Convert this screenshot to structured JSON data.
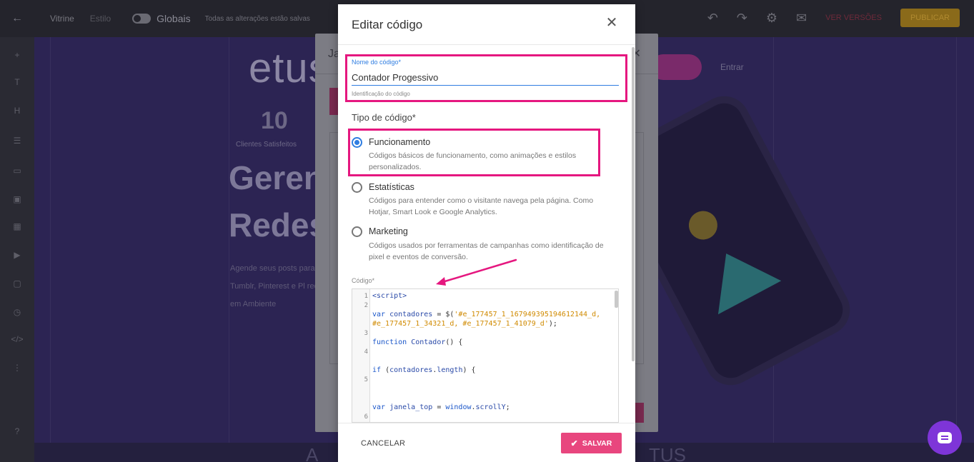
{
  "background": {
    "topbar": {
      "back_icon": "arrow-left-icon",
      "page_label": "Vitrine",
      "dim_label": "Estilo",
      "globais_label": "Globais",
      "autosave_text": "Todas as alterações estão salvas",
      "version_label": "VER VERSÕES",
      "publish_label": "PUBLICAR"
    },
    "canvas": {
      "logo": "etus",
      "stat_number": "10",
      "stat_label": "Clientes Satisfeitos",
      "hero_line1": "Geren",
      "hero_line2": "Redes",
      "paragraph": "Agende seus posts para Tumblr, Pinterest e Pl redes em Ambiente",
      "entrar_label": "Entrar",
      "bottom_text_left": "A",
      "bottom_text_right": "TUS"
    },
    "mid_dialog": {
      "title": "Ja"
    }
  },
  "modal": {
    "title": "Editar código",
    "close_icon": "close-icon",
    "name_field": {
      "label": "Nome do código*",
      "value": "Contador Progessivo",
      "helper": "Identificação do código"
    },
    "type_label": "Tipo de código*",
    "options": [
      {
        "title": "Funcionamento",
        "description": "Códigos básicos de funcionamento, como animações e estilos personalizados.",
        "selected": true
      },
      {
        "title": "Estatísticas",
        "description": "Códigos para entender como o visitante navega pela página. Como Hotjar, Smart Look e Google Analytics.",
        "selected": false
      },
      {
        "title": "Marketing",
        "description": "Códigos usados por ferramentas de campanhas como identificação de pixel e eventos de conversão.",
        "selected": false
      }
    ],
    "code_label": "Código*",
    "code_lines": {
      "n1": "1",
      "n2": "2",
      "n3": "3",
      "n4": "4",
      "n5": "5",
      "n6": "6",
      "l1": "<script>",
      "l2a_kw": "var",
      "l2a_var": " contadores",
      "l2a_op": " = $(",
      "l2a_str": "'#e_177457_1_167949395194612144_d,",
      "l2b_str": "#e_177457_1_34321_d, #e_177457_1_41079_d'",
      "l2b_end": ");",
      "l3_kw": "function",
      "l3_name": " Contador",
      "l3_end": "() {",
      "l4_kw": "if",
      "l4_rest1": " (",
      "l4_var": "contadores",
      "l4_rest2": ".",
      "l4_prop": "length",
      "l4_end": ") {",
      "l5_kw": "var",
      "l5_var": " janela_top",
      "l5_op": " = ",
      "l5_obj": "window",
      "l5_dot": ".",
      "l5_prop": "scrollY",
      "l5_end": ";"
    },
    "footer": {
      "cancel_label": "CANCELAR",
      "save_label": "SALVAR",
      "save_icon": "check-icon"
    }
  },
  "annotations": {
    "highlight_color": "#e5177f",
    "arrow_color": "#e5177f"
  },
  "chat_fab": {
    "icon": "chat-icon",
    "color": "#7e35d8"
  },
  "colors": {
    "accent_blue": "#2f7de1",
    "save_pink": "#e8467e"
  }
}
